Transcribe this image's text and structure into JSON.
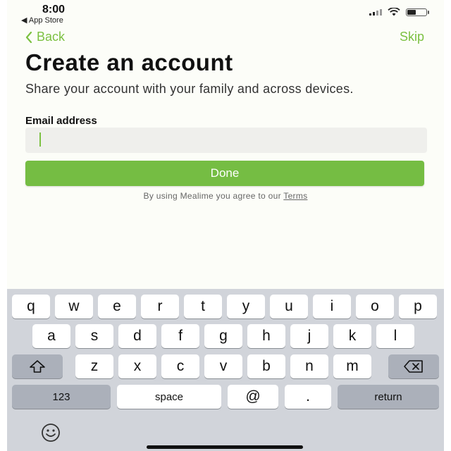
{
  "status_bar": {
    "time": "8:00",
    "back_app": "◀ App Store"
  },
  "nav": {
    "back_label": "Back",
    "skip_label": "Skip"
  },
  "title": "Create an account",
  "subtitle": "Share your account with your family and across devices.",
  "email": {
    "label": "Email address",
    "value": "",
    "placeholder": ""
  },
  "done_label": "Done",
  "terms": {
    "prefix": "By using Mealime you agree to our ",
    "link": "Terms"
  },
  "colors": {
    "accent": "#7cc142",
    "button": "#75bd43",
    "keyboard_bg": "#d1d4da"
  },
  "keyboard": {
    "row1": [
      "q",
      "w",
      "e",
      "r",
      "t",
      "y",
      "u",
      "i",
      "o",
      "p"
    ],
    "row2": [
      "a",
      "s",
      "d",
      "f",
      "g",
      "h",
      "j",
      "k",
      "l"
    ],
    "row3": [
      "z",
      "x",
      "c",
      "v",
      "b",
      "n",
      "m"
    ],
    "shift_icon": "shift-icon",
    "delete_icon": "delete-icon",
    "numbers": "123",
    "space": "space",
    "at": "@",
    "dot": ".",
    "return": "return",
    "emoji_icon": "emoji-icon"
  }
}
